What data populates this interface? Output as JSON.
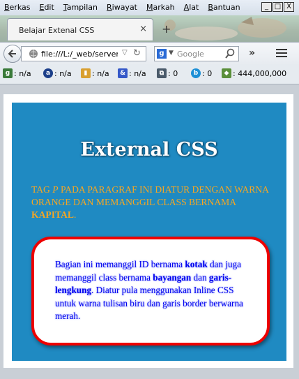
{
  "menu": [
    "Berkas",
    "Edit",
    "Tampilan",
    "Riwayat",
    "Markah",
    "Alat",
    "Bantuan"
  ],
  "window_controls": {
    "minimize": "_",
    "maximize": "□",
    "close": "X"
  },
  "tab": {
    "title": "Belajar Extenal CSS",
    "close": "×",
    "new_tab": "+"
  },
  "nav": {
    "url": "file:///L:/_web/server2",
    "search_placeholder": "Google",
    "overflow": "»"
  },
  "addons": [
    {
      "icon": "pagerank-icon",
      "value": ": n/a"
    },
    {
      "icon": "alexa-icon",
      "value": ": n/a"
    },
    {
      "icon": "stats-icon",
      "value": ": n/a"
    },
    {
      "icon": "index-icon",
      "value": ": n/a"
    },
    {
      "icon": "backlink-icon",
      "value": ": 0"
    },
    {
      "icon": "bing-icon",
      "value": ": 0"
    },
    {
      "icon": "rank-icon",
      "value": ": 444,000,000"
    }
  ],
  "page": {
    "heading": "External CSS",
    "paragraph": {
      "before_p": "TAG ",
      "p": "P",
      "middle": " PADA PARAGRAF INI DIATUR DENGAN WARNA ORANGE DAN MEMANGGIL CLASS BERNAMA ",
      "kapital": "KAPITAL",
      "end": "."
    },
    "box": {
      "t1": "Bagian ini memanggil ID bernama ",
      "kotak": "kotak",
      "t2": " dan juga memanggil class bernama ",
      "bayangan": "bayangan",
      "t3": " dan ",
      "lengkung": "garis-lengkung",
      "t4": ". Diatur pula menggunakan Inline CSS untuk warna tulisan biru dan garis border berwarna merah."
    }
  }
}
